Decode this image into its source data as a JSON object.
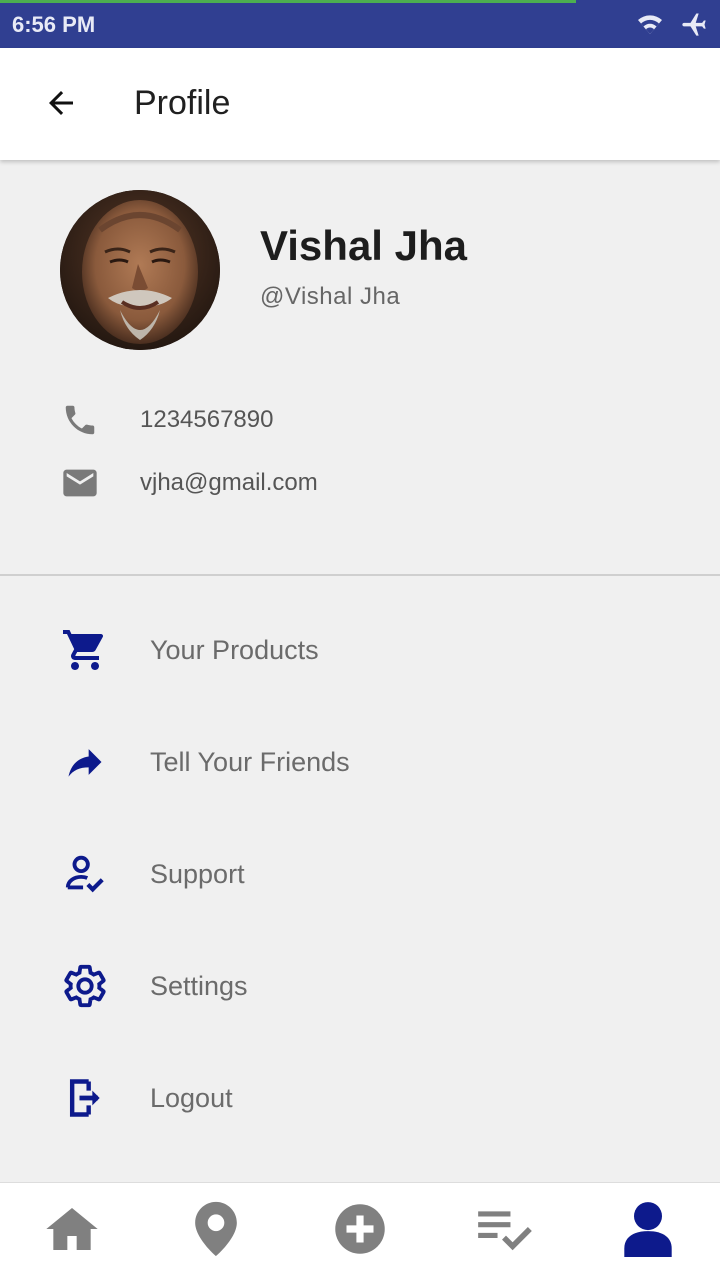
{
  "status_bar": {
    "time": "6:56 PM",
    "icons": [
      "wifi-icon",
      "airplane-icon"
    ],
    "progress_fraction": 0.8
  },
  "header": {
    "title": "Profile",
    "back_icon": "arrow-left-icon"
  },
  "profile": {
    "name": "Vishal Jha",
    "handle": "@Vishal Jha",
    "phone": "1234567890",
    "email": "vjha@gmail.com"
  },
  "menu": {
    "items": [
      {
        "label": "Your Products",
        "icon": "cart-icon"
      },
      {
        "label": "Tell Your Friends",
        "icon": "share-icon"
      },
      {
        "label": "Support",
        "icon": "support-icon"
      },
      {
        "label": "Settings",
        "icon": "gear-icon"
      },
      {
        "label": "Logout",
        "icon": "logout-icon"
      }
    ]
  },
  "bottom_nav": {
    "items": [
      "home-icon",
      "location-icon",
      "add-icon",
      "checklist-icon",
      "profile-icon"
    ],
    "active": "profile-icon"
  },
  "colors": {
    "status_bar": "#303f91",
    "accent": "#0d1a8c",
    "inactive_nav": "#808080",
    "background": "#f0f0f0"
  }
}
